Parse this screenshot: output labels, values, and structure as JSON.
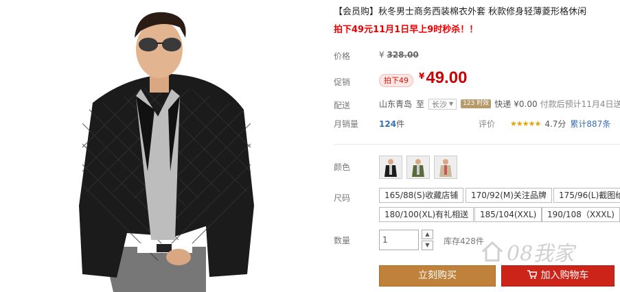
{
  "product": {
    "title": "【会员购】秋冬男士商务西装棉衣外套 秋款修身轻薄菱形格休闲",
    "promo": "拍下49元11月1日早上9时秒杀！！"
  },
  "price_row": {
    "label": "价格",
    "currency": "¥",
    "original": "328.00"
  },
  "promo_row": {
    "label": "促销",
    "badge": "拍下49",
    "currency": "¥",
    "price": "49.00"
  },
  "shipping": {
    "label": "配送",
    "origin": "山东青岛",
    "to": "至",
    "city": "长沙",
    "timely_badge": "123 时效",
    "courier": "快递",
    "fee": "¥0.00",
    "note": "付款后预计11月4日送"
  },
  "sales": {
    "label": "月销量",
    "count": "124",
    "unit": "件"
  },
  "rating": {
    "label": "评价",
    "stars": "★★★★★",
    "score": "4.7分",
    "reviews": "累计887条"
  },
  "color": {
    "label": "颜色"
  },
  "size": {
    "label": "尺码",
    "options": [
      "165/88(S)收藏店铺",
      "170/92(M)关注品牌",
      "175/96(L)截图给",
      "180/100(XL)有礼相送",
      "185/104(XXL)",
      "190/108（XXXL)"
    ]
  },
  "quantity": {
    "label": "数量",
    "value": "1",
    "stock": "库存428件"
  },
  "buttons": {
    "buy_now": "立刻购买",
    "add_cart": "加入购物车"
  },
  "watermark": "08我家",
  "colors": {
    "price_red": "#cc0000",
    "buy_btn": "#c0813a",
    "cart_btn": "#cc2418",
    "link_blue": "#3a6fb6",
    "star": "#e6a300"
  }
}
